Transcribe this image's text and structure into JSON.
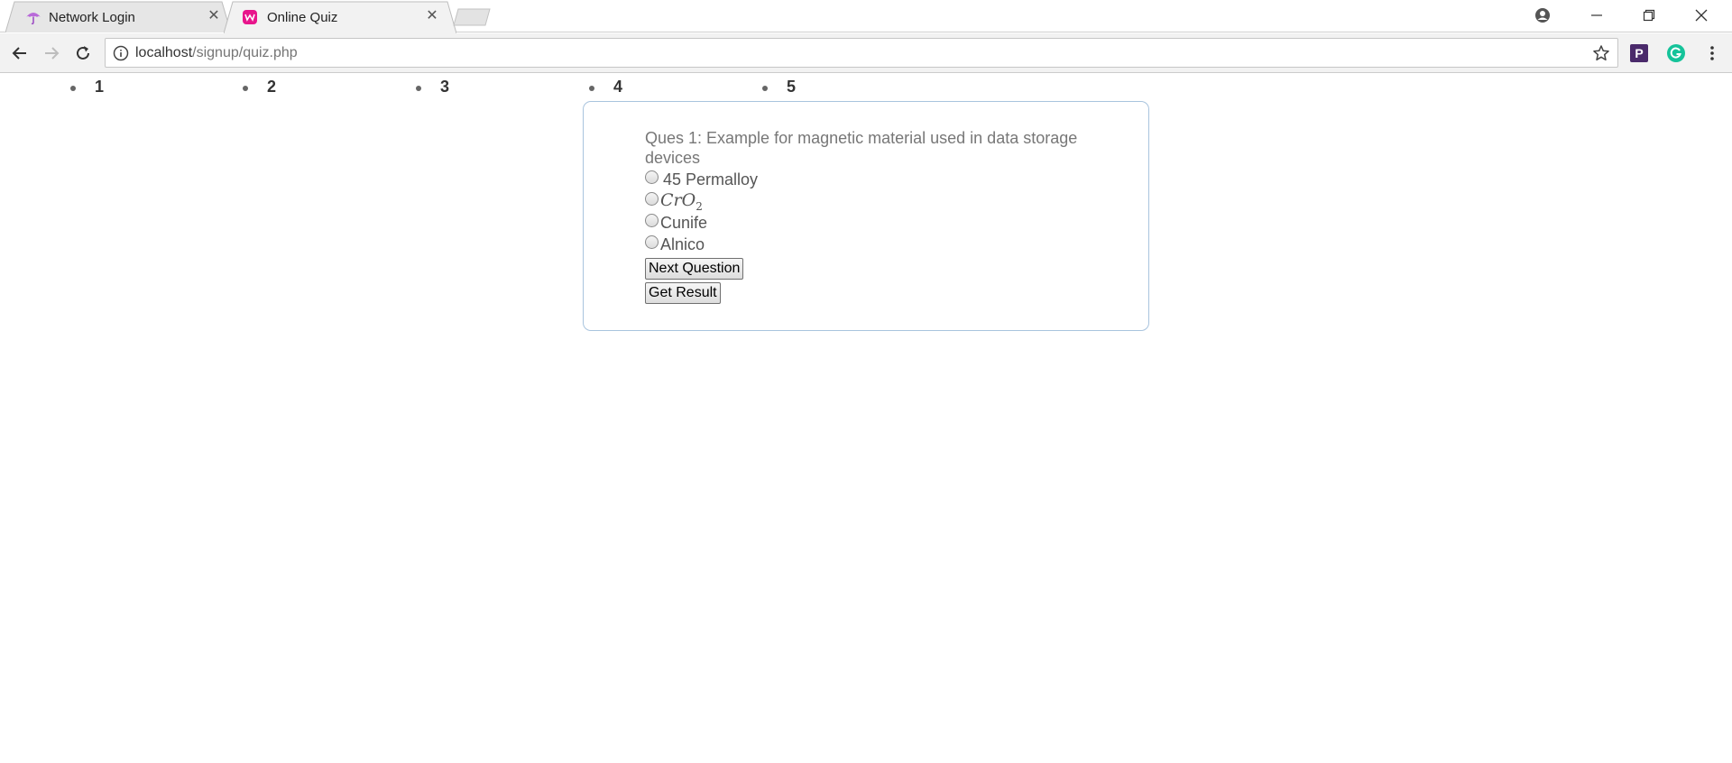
{
  "browser": {
    "tabs": [
      {
        "title": "Network Login",
        "active": false,
        "favicon": "umbrella-icon"
      },
      {
        "title": "Online Quiz",
        "active": true,
        "favicon": "wamp-icon"
      }
    ],
    "address": {
      "host": "localhost",
      "path": "/signup/quiz.php"
    },
    "extensions": [
      {
        "name": "p-extension-icon",
        "letter": "P",
        "color": "#4a2a6b"
      },
      {
        "name": "grammarly-icon",
        "letter": "G",
        "color": "#15c39a"
      }
    ]
  },
  "quiz_nav": {
    "items": [
      "1",
      "2",
      "3",
      "4",
      "5"
    ]
  },
  "quiz": {
    "question": "Ques 1: Example for magnetic material used in data storage devices",
    "options": [
      {
        "label": "45 Permalloy"
      },
      {
        "label": "CrO",
        "subscript": "2"
      },
      {
        "label": "Cunife"
      },
      {
        "label": "Alnico"
      }
    ],
    "next_label": "Next Question",
    "result_label": "Get Result"
  },
  "colors": {
    "card_border": "#a9c4de",
    "question_text": "#777777",
    "wamp_pink": "#e8158c"
  }
}
